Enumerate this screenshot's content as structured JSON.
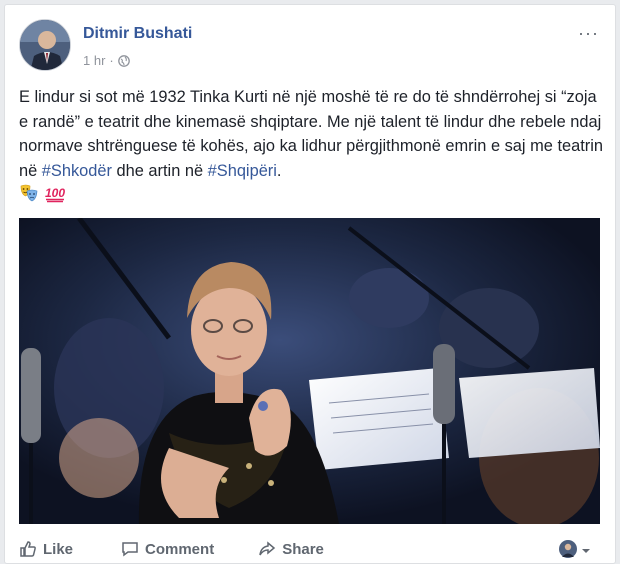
{
  "post": {
    "author": "Ditmir Bushati",
    "time": "1 hr",
    "separator": "·",
    "more": "···",
    "text_part1": "E lindur si sot më 1932 Tinka Kurti në një moshë të re do të shndërrohej si “zoja e randë” e teatrit dhe kinemasë shqiptare. Me një talent të lindur dhe rebele ndaj normave shtrënguese të kohës, ajo ka lidhur përgjithmonë emrin e saj me teatrin në ",
    "hashtag1": "#Shkodër",
    "text_part2": " dhe artin në ",
    "hashtag2": "#Shqipëri",
    "text_part3": "."
  },
  "emojis": [
    "theater-masks-icon",
    "hundred-points-icon"
  ],
  "actions": {
    "like": "Like",
    "comment": "Comment",
    "share": "Share"
  },
  "colors": {
    "link": "#365899",
    "meta": "#90949c",
    "hundred": "#e0245e"
  }
}
